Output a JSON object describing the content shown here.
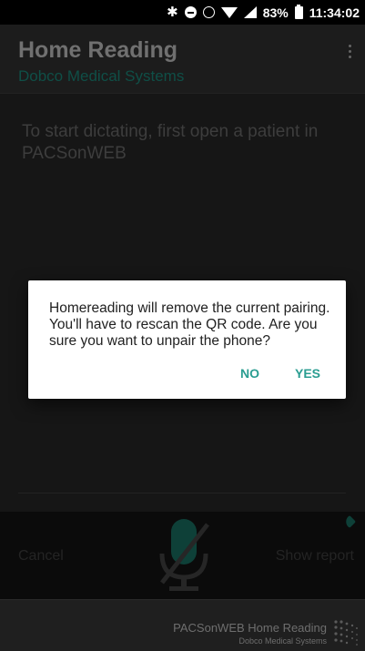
{
  "status_bar": {
    "battery_percent": "83%",
    "time": "11:34:02",
    "icons": [
      "bluetooth-icon",
      "do-not-disturb-icon",
      "alarm-icon",
      "wifi-icon",
      "signal-icon",
      "battery-icon"
    ]
  },
  "app_bar": {
    "title": "Home Reading",
    "subtitle": "Dobco Medical Systems",
    "menu_icon": "more-vert-icon"
  },
  "content": {
    "hint": "To start dictating, first open a patient in PACSonWEB"
  },
  "controls": {
    "cancel_label": "Cancel",
    "show_report_label": "Show report",
    "mic_icon": "mic-off-icon",
    "pencil_icon": "pencil-icon"
  },
  "footer": {
    "title": "PACSonWEB Home Reading",
    "subtitle": "Dobco Medical Systems",
    "logo_icon": "dobco-logo-icon"
  },
  "dialog": {
    "message": "Homereading will remove the current pairing. You'll have to rescan the QR code. Are you sure you want to unpair the phone?",
    "no_label": "NO",
    "yes_label": "YES"
  },
  "colors": {
    "accent": "#2a9d91",
    "accent_dim": "#0f4f47",
    "background": "#161616",
    "dialog_bg": "#ffffff"
  }
}
